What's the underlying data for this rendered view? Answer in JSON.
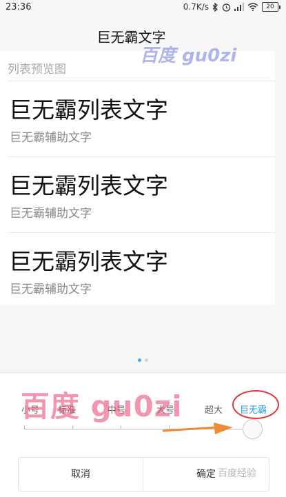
{
  "status_bar": {
    "time": "23:36",
    "network_speed": "0.7K/s",
    "battery_level": "20",
    "icons": [
      "bluetooth-icon",
      "alarm-icon",
      "signal-icon",
      "wifi-icon",
      "battery-icon"
    ]
  },
  "title": "巨无霸文字",
  "preview": {
    "header": "列表预览图",
    "items": [
      {
        "primary": "巨无霸列表文字",
        "secondary": "巨无霸辅助文字"
      },
      {
        "primary": "巨无霸列表文字",
        "secondary": "巨无霸辅助文字"
      },
      {
        "primary": "巨无霸列表文字",
        "secondary": "巨无霸辅助文字"
      }
    ]
  },
  "pager": {
    "count": 2,
    "active_index": 0
  },
  "font_size_picker": {
    "levels": [
      "小号",
      "标准",
      "中号",
      "大号",
      "超大",
      "巨无霸"
    ],
    "selected_index": 5,
    "selected_label": "巨无霸"
  },
  "buttons": {
    "cancel": "取消",
    "confirm": "确定"
  },
  "watermarks": {
    "top_right": "百度 gu0zi",
    "middle": "百度 gu0zi",
    "bottom_right": "百度经验"
  },
  "colors": {
    "accent_blue": "#2a9ee0",
    "annotation_red": "#e3333a",
    "annotation_orange": "#f28a30"
  }
}
